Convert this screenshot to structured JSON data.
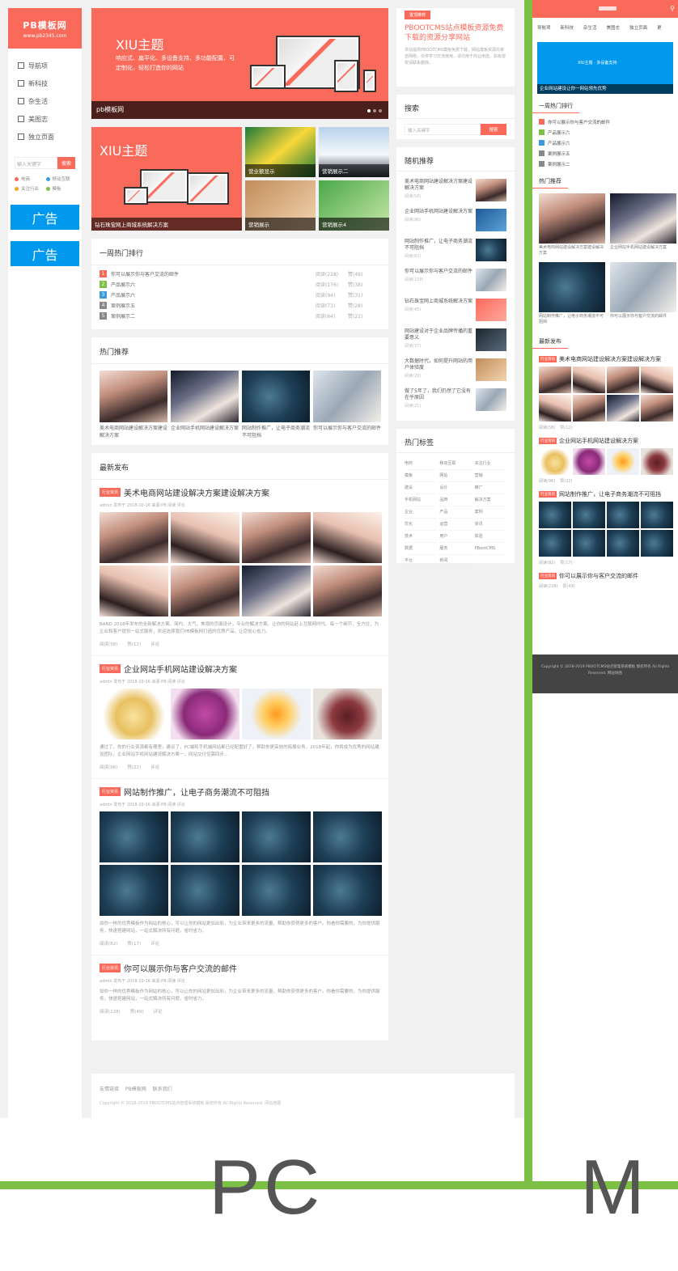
{
  "colors": {
    "brand": "#fa6a5b",
    "ad_blue": "#0099ee",
    "green": "#7cc045",
    "footer_dark": "#444444"
  },
  "labels": {
    "pc": "PC",
    "m": "M"
  },
  "pc": {
    "sidebar": {
      "logo_line1": "PB模板网",
      "logo_line2": "www.pb2345.com",
      "nav": [
        "导航项",
        "新科技",
        "杂生活",
        "美图志",
        "独立页面"
      ],
      "search_placeholder": "输入关键字",
      "search_button": "搜索",
      "tags": [
        {
          "label": "电商",
          "color": "#fa6a5b"
        },
        {
          "label": "移动互联",
          "color": "#3b9ade"
        },
        {
          "label": "关注行业",
          "color": "#f5a623"
        },
        {
          "label": "模板",
          "color": "#7cc045"
        }
      ],
      "ads": [
        "广告",
        "广告"
      ]
    },
    "slider": {
      "title": "XIU主题",
      "subtitle": "响应式、扁平化、多设备支持、多功能配置、可定制化，轻松打造你的网站",
      "caption": "pb模板网"
    },
    "featured": {
      "big_title": "XIU主题",
      "big_caption": "钻石珠宝网上商城系统解决方案",
      "small": [
        "营业额显示",
        "营销展示二",
        "营销展示",
        "营销展示4"
      ]
    },
    "weekly_hot": {
      "title": "一周热门排行",
      "items": [
        {
          "title": "你可以展示你与客户交流的邮件",
          "views": "阅读(228)",
          "likes": "赞(49)",
          "color": "#fa6a5b"
        },
        {
          "title": "产品展示六",
          "views": "阅读(176)",
          "likes": "赞(38)",
          "color": "#7cc045"
        },
        {
          "title": "产品展示六",
          "views": "阅读(94)",
          "likes": "赞(31)",
          "color": "#3b9ade"
        },
        {
          "title": "案例展示五",
          "views": "阅读(73)",
          "likes": "赞(28)",
          "color": "#888888"
        },
        {
          "title": "案例展示二",
          "views": "阅读(64)",
          "likes": "赞(22)",
          "color": "#888888"
        }
      ]
    },
    "hot_recs": {
      "title": "热门推荐",
      "items": [
        {
          "caption": "美术电商网站建设解决方案建设解决方案"
        },
        {
          "caption": "企业网站手机网站建设解决方案"
        },
        {
          "caption": "网站制作推广，让电子商务潮流不可阻挡"
        },
        {
          "caption": "你可以展示你与客户交流的邮件"
        }
      ]
    },
    "latest": {
      "title": "最新发布",
      "posts": [
        {
          "badge": "行业资讯",
          "title": "美术电商网站建设解决方案建设解决方案",
          "meta": "admin 发布于 2018-10-16 来源:PB    阅读    评论",
          "excerpt": "BAND 2018年发布的全新解决方案。简约、大气，美观的页面设计，专业的解决方案，让你的网站赶上互联网时代。每一个细节，全方位，为企业和客户提供一站式服务，欢迎选择我们PB模板网打造的优质产品，让您省心省力。",
          "foot": [
            "阅读(58)",
            "赞(12)",
            "评论"
          ]
        },
        {
          "badge": "行业资讯",
          "title": "企业网站手机网站建设解决方案",
          "meta": "admin 发布于 2018-10-16 来源:PB    阅读    评论",
          "excerpt": "通过了，你的行业资源都有哪里，建议了，PC端和手机端网站都已经配置好了，帮助你更高效的拓展业务，2018年起，你将成为优秀的网站建设团队，企业网站手机网站建设解决方案一，网站交付仅需四步…",
          "foot": [
            "阅读(96)",
            "赞(22)",
            "评论"
          ]
        },
        {
          "badge": "行业资讯",
          "title": "网站制作推广，让电子商务潮流不可阻挡",
          "meta": "admin 发布于 2018-10-16 来源:PB    阅读    评论",
          "excerpt": "如你一样的优秀模板作为网站的核心，可以让你的网站更加出彩，为企业带来更多的流量，帮助你获得更多的客户。你看你需要的，为你提供服务，快速搭建网站，一站式解决所有问题，省时省力。",
          "foot": [
            "阅读(82)",
            "赞(17)",
            "评论"
          ]
        },
        {
          "badge": "行业资讯",
          "title": "你可以展示你与客户交流的邮件",
          "meta": "admin 发布于 2018-10-16 来源:PB    阅读    评论",
          "excerpt": "如你一样的优秀模板作为网站的核心，可以让你的网站更加出彩，为企业带来更多的流量，帮助你获得更多的客户。你看你需要的，为你提供服务，快速搭建网站，一站式解决所有问题，省时省力。",
          "foot": [
            "阅读(228)",
            "赞(49)",
            "评论"
          ]
        }
      ]
    },
    "footer": {
      "links": [
        "友情链接",
        "PB模板网",
        "联系我们"
      ],
      "copyright": "Copyright © 2018-2019 PBOOTCMS站点管理系统模板 版权所有 All Rights Reserved.   网站地图"
    },
    "right": {
      "pboot_badge": "置顶推荐",
      "pboot_title": "PBOOTCMS站点模板资源免费下载的资源分享网站",
      "pboot_desc": "本站提供PBOOTCMS模板免费下载，网站模板资源均来自网络，仅供学习交流使用，请勿用于商业用途。如有侵权请联系删除。",
      "search_title": "搜索",
      "search_placeholder": "输入关键字",
      "search_button": "搜索",
      "random_title": "随机推荐",
      "random": [
        {
          "title": "美术电商网站建设解决方案建设解决方案",
          "meta": "阅读(58)"
        },
        {
          "title": "企业网站手机网站建设解决方案",
          "meta": "阅读(96)"
        },
        {
          "title": "网站制作推广，让电子商务潮流不可阻挡",
          "meta": "阅读(82)"
        },
        {
          "title": "你可以展示你与客户交流的邮件",
          "meta": "阅读(228)"
        },
        {
          "title": "钻石珠宝网上商城系统解决方案",
          "meta": "阅读(45)"
        },
        {
          "title": "网站建设对于企业品牌传播的重要意义",
          "meta": "阅读(37)"
        },
        {
          "title": "大数据时代，如何提升网站的用户体验度",
          "meta": "阅读(29)"
        },
        {
          "title": "做了5年了，我们仍然了它没有在乎原因",
          "meta": "阅读(21)"
        }
      ],
      "tags_title": "热门标签",
      "tags": [
        "电商",
        "移动互联",
        "关注行业",
        "模板",
        "网站",
        "营销",
        "建设",
        "设计",
        "推广",
        "手机网站",
        "品牌",
        "解决方案",
        "企业",
        "产品",
        "案例",
        "优化",
        "运营",
        "资讯",
        "技术",
        "用户",
        "体验",
        "数据",
        "服务",
        "PBootCMS",
        "平台",
        "新闻"
      ]
    }
  },
  "m": {
    "nav": [
      "导航项",
      "新科技",
      "杂生活",
      "美图志",
      "独立页面",
      "更"
    ],
    "banner_text": "XIU主题 · 多设备支持",
    "banner_caption": "企业网站建设让你一网站领先优势",
    "weekly_title": "一周热门排行",
    "weekly": [
      "你可以展示你与客户交流的邮件",
      "产品展示六",
      "产品展示六",
      "案例展示五",
      "案例展示二"
    ],
    "hot_title": "热门推荐",
    "hot": [
      "美术电商网站建设解决方案建设解决方案",
      "企业网站手机网站建设解决方案",
      "网站制作推广，让电子商务潮流不可阻挡",
      "你可以展示你与客户交流的邮件"
    ],
    "latest_title": "最新发布",
    "posts": [
      {
        "badge": "行业资讯",
        "title": "美术电商网站建设解决方案建设解决方案",
        "meta": [
          "阅读(58)",
          "赞(12)"
        ]
      },
      {
        "badge": "行业资讯",
        "title": "企业网站手机网站建设解决方案",
        "meta": [
          "阅读(96)",
          "赞(22)"
        ]
      },
      {
        "badge": "行业资讯",
        "title": "网站制作推广，让电子商务潮流不可阻挡",
        "meta": [
          "阅读(82)",
          "赞(17)"
        ]
      },
      {
        "badge": "行业资讯",
        "title": "你可以展示你与客户交流的邮件",
        "meta": [
          "阅读(228)",
          "赞(49)"
        ]
      }
    ],
    "footer": "Copyright © 2018-2019 PBOOTCMS站点管理系统模板 版权所有 All Rights Reserved.   网站地图"
  }
}
